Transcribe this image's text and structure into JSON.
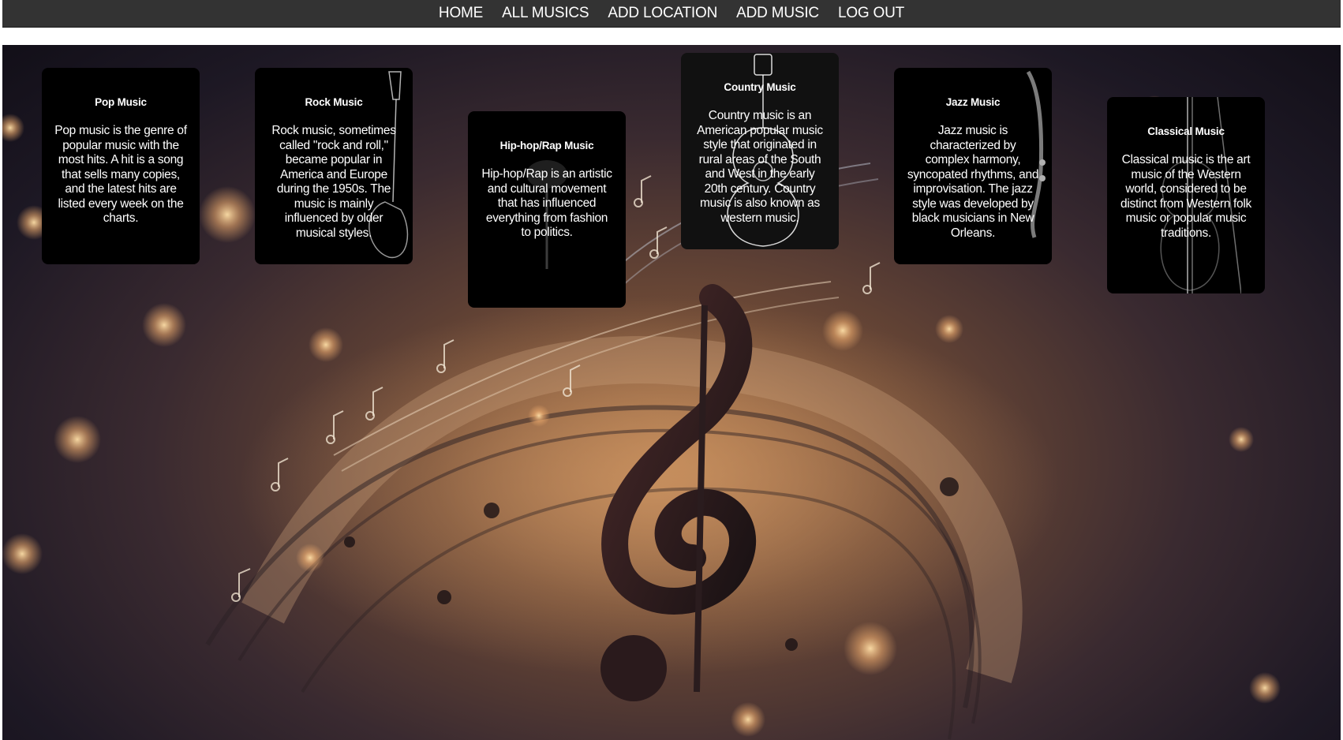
{
  "nav": {
    "items": [
      {
        "label": "HOME"
      },
      {
        "label": "ALL MUSICS"
      },
      {
        "label": "ADD LOCATION"
      },
      {
        "label": "ADD MUSIC"
      },
      {
        "label": "LOG OUT"
      }
    ]
  },
  "genres": [
    {
      "title": "Pop Music",
      "description": "Pop music is the genre of popular music with the most hits. A hit is a song that sells many copies, and the latest hits are listed every week on the charts."
    },
    {
      "title": "Rock Music",
      "description": "Rock music, sometimes called \"rock and roll,\" became popular in America and Europe during the 1950s. The music is mainly influenced by older musical styles."
    },
    {
      "title": "Hip-hop/Rap Music",
      "description": "Hip-hop/Rap is an artistic and cultural movement that has influenced everything from fashion to politics."
    },
    {
      "title": "Country Music",
      "description": "Country music is an American popular music style that originated in rural areas of the South and West in the early 20th century. Country music is also known as western music."
    },
    {
      "title": "Jazz Music",
      "description": "Jazz music is characterized by complex harmony, syncopated rhythms, and improvisation. The jazz style was developed by black musicians in New Orleans."
    },
    {
      "title": "Classical Music",
      "description": "Classical music is the art music of the Western world, considered to be distinct from Western folk music or popular music traditions."
    }
  ],
  "theme": {
    "navbar_bg": "#333333",
    "card_bg": "#000000",
    "text": "#ffffff"
  }
}
